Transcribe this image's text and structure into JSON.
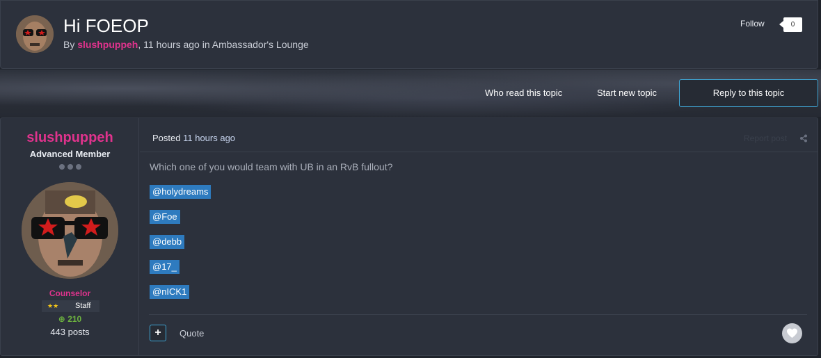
{
  "topic": {
    "title": "Hi FOEOP",
    "by_label": "By",
    "author": "slushpuppeh",
    "time": "11 hours ago",
    "in_label": "in",
    "forum": "Ambassador's Lounge",
    "follow_label": "Follow",
    "follow_count": "0"
  },
  "banner": {
    "who_read": "Who read this topic",
    "start_new": "Start new topic",
    "reply": "Reply to this topic"
  },
  "post": {
    "author_name": "slushpuppeh",
    "author_rank": "Advanced Member",
    "group": "Counselor",
    "badge": "Staff",
    "reputation": "210",
    "post_count": "443 posts",
    "posted_label": "Posted",
    "posted_time": "11 hours ago",
    "report_label": "Report post",
    "body": "Which one of you would team with UB in an RvB fullout?",
    "mentions": [
      "@holydreams",
      "@Foe",
      "@debb",
      "@17_",
      "@nICK1"
    ],
    "quote_label": "Quote"
  },
  "colors": {
    "accent_pink": "#e0338d",
    "accent_blue": "#3fa7d6",
    "mention_bg": "#2e7bbf",
    "reputation_green": "#6db33f"
  },
  "icons": [
    "share-icon",
    "heart-icon",
    "plus-icon",
    "star-icon"
  ]
}
